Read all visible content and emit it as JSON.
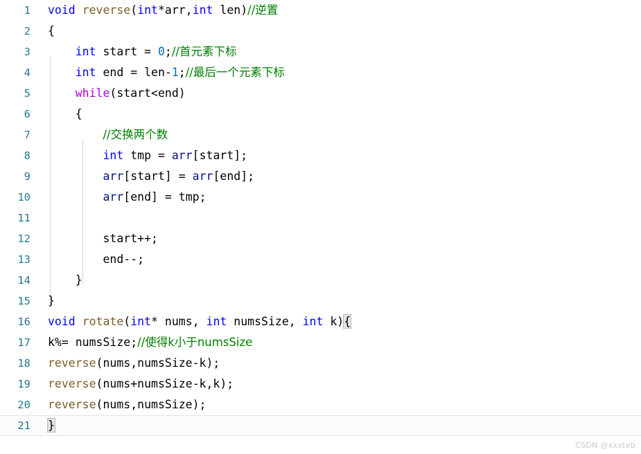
{
  "editor": {
    "language": "c",
    "first_line": 1,
    "last_line": 21,
    "total_lines": 21,
    "active_line": 21,
    "colors": {
      "background": "#ffffff",
      "line_number": "#237893",
      "keyword": "#0000ff",
      "control_keyword": "#af00db",
      "function": "#795e26",
      "variable": "#001080",
      "number": "#0070c1",
      "comment": "#008000",
      "text": "#000000",
      "indent_guide": "#d3d3d3",
      "brace_match_bg": "#e3e3e3",
      "active_line_border": "#e4e4e4"
    }
  },
  "lines": [
    {
      "n": "1",
      "text": "void reverse(int*arr,int len)//逆置"
    },
    {
      "n": "2",
      "text": "{"
    },
    {
      "n": "3",
      "text": "    int start = 0;//首元素下标"
    },
    {
      "n": "4",
      "text": "    int end = len-1;//最后一个元素下标"
    },
    {
      "n": "5",
      "text": "    while(start<end)"
    },
    {
      "n": "6",
      "text": "    {"
    },
    {
      "n": "7",
      "text": "        //交换两个数"
    },
    {
      "n": "8",
      "text": "        int tmp = arr[start];"
    },
    {
      "n": "9",
      "text": "        arr[start] = arr[end];"
    },
    {
      "n": "10",
      "text": "        arr[end] = tmp;"
    },
    {
      "n": "11",
      "text": ""
    },
    {
      "n": "12",
      "text": "        start++;"
    },
    {
      "n": "13",
      "text": "        end--;"
    },
    {
      "n": "14",
      "text": "    }"
    },
    {
      "n": "15",
      "text": "}"
    },
    {
      "n": "16",
      "text": "void rotate(int* nums, int numsSize, int k){"
    },
    {
      "n": "17",
      "text": "k%= numsSize;//使得k小于numsSize"
    },
    {
      "n": "18",
      "text": "reverse(nums,numsSize-k);"
    },
    {
      "n": "19",
      "text": "reverse(nums+numsSize-k,k);"
    },
    {
      "n": "20",
      "text": "reverse(nums,numsSize);"
    },
    {
      "n": "21",
      "text": "}"
    }
  ],
  "tokens": {
    "kw_void": "void",
    "kw_int": "int",
    "ctrl_while": "while",
    "fn_reverse": "reverse",
    "fn_rotate": "rotate",
    "var_arr": "arr",
    "num_zero": "0",
    "num_one": "1",
    "comment_1": "//逆置",
    "comment_3": "//首元素下标",
    "comment_4": "//最后一个元素下标",
    "comment_7": "//交换两个数",
    "comment_17": "//使得k小于numsSize"
  },
  "line_numbers": {
    "l1": "1",
    "l2": "2",
    "l3": "3",
    "l4": "4",
    "l5": "5",
    "l6": "6",
    "l7": "7",
    "l8": "8",
    "l9": "9",
    "l10": "10",
    "l11": "11",
    "l12": "12",
    "l13": "13",
    "l14": "14",
    "l15": "15",
    "l16": "16",
    "l17": "17",
    "l18": "18",
    "l19": "19",
    "l20": "20",
    "l21": "21"
  },
  "code": {
    "l1_a": "void",
    "l1_b": " ",
    "l1_c": "reverse",
    "l1_d": "(",
    "l1_e": "int",
    "l1_f": "*arr,",
    "l1_g": "int",
    "l1_h": " len)",
    "l1_i": "//逆置",
    "l2_a": "{",
    "l3_a": "    ",
    "l3_b": "int",
    "l3_c": " start = ",
    "l3_d": "0",
    "l3_e": ";",
    "l3_f": "//首元素下标",
    "l4_a": "    ",
    "l4_b": "int",
    "l4_c": " end = len-",
    "l4_d": "1",
    "l4_e": ";",
    "l4_f": "//最后一个元素下标",
    "l5_a": "    ",
    "l5_b": "while",
    "l5_c": "(start<end)",
    "l6_a": "    {",
    "l7_a": "        ",
    "l7_b": "//交换两个数",
    "l8_a": "        ",
    "l8_b": "int",
    "l8_c": " tmp = ",
    "l8_d": "arr",
    "l8_e": "[start];",
    "l9_a": "        ",
    "l9_b": "arr",
    "l9_c": "[start] = ",
    "l9_d": "arr",
    "l9_e": "[end];",
    "l10_a": "        ",
    "l10_b": "arr",
    "l10_c": "[end] = tmp;",
    "l11_a": "",
    "l12_a": "        start++;",
    "l13_a": "        end--;",
    "l14_a": "    }",
    "l15_a": "}",
    "l16_a": "void",
    "l16_b": " ",
    "l16_c": "rotate",
    "l16_d": "(",
    "l16_e": "int",
    "l16_f": "* nums, ",
    "l16_g": "int",
    "l16_h": " numsSize, ",
    "l16_i": "int",
    "l16_j": " k)",
    "l16_k": "{",
    "l17_a": "k%= numsSize;",
    "l17_b": "//使得k小于numsSize",
    "l18_a": "reverse",
    "l18_b": "(nums,numsSize-k);",
    "l19_a": "reverse",
    "l19_b": "(nums+numsSize-k,k);",
    "l20_a": "reverse",
    "l20_b": "(nums,numsSize);",
    "l21_a": "}"
  },
  "watermark": {
    "text": "CSDN @xxxteb"
  }
}
